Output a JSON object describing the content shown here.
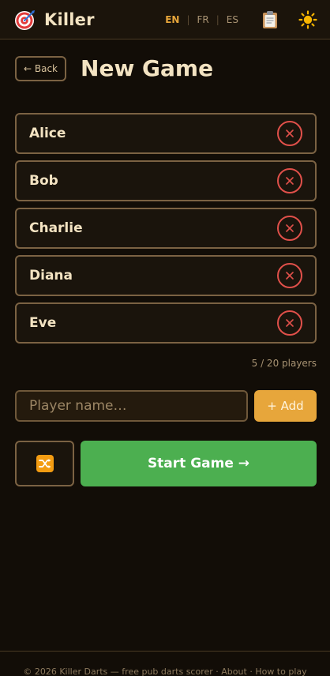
{
  "app": {
    "title": "Killer",
    "logo_icon": "target-icon"
  },
  "languages": {
    "items": [
      "EN",
      "FR",
      "ES"
    ],
    "active": "EN",
    "separator": "|"
  },
  "toolbar": {
    "clipboard_icon": "clipboard-icon",
    "theme_icon": "sun-icon"
  },
  "header": {
    "back_label": "← Back",
    "page_title": "New Game"
  },
  "players": [
    {
      "name": "Alice"
    },
    {
      "name": "Bob"
    },
    {
      "name": "Charlie"
    },
    {
      "name": "Diana"
    },
    {
      "name": "Eve"
    }
  ],
  "player_count": "5 / 20 players",
  "add_player": {
    "value": "",
    "placeholder": "Player name…",
    "button_label": "+ Add"
  },
  "actions": {
    "shuffle_icon": "shuffle-icon",
    "start_label": "Start Game →"
  },
  "footer": {
    "text": "© 2026 Killer Darts — free pub darts scorer",
    "separator": "·",
    "links": [
      "About",
      "How to play"
    ]
  },
  "colors": {
    "background": "#120d07",
    "accent": "#e7a63b",
    "start": "#4caf50",
    "remove": "#e0504a",
    "border": "#7b6243"
  }
}
